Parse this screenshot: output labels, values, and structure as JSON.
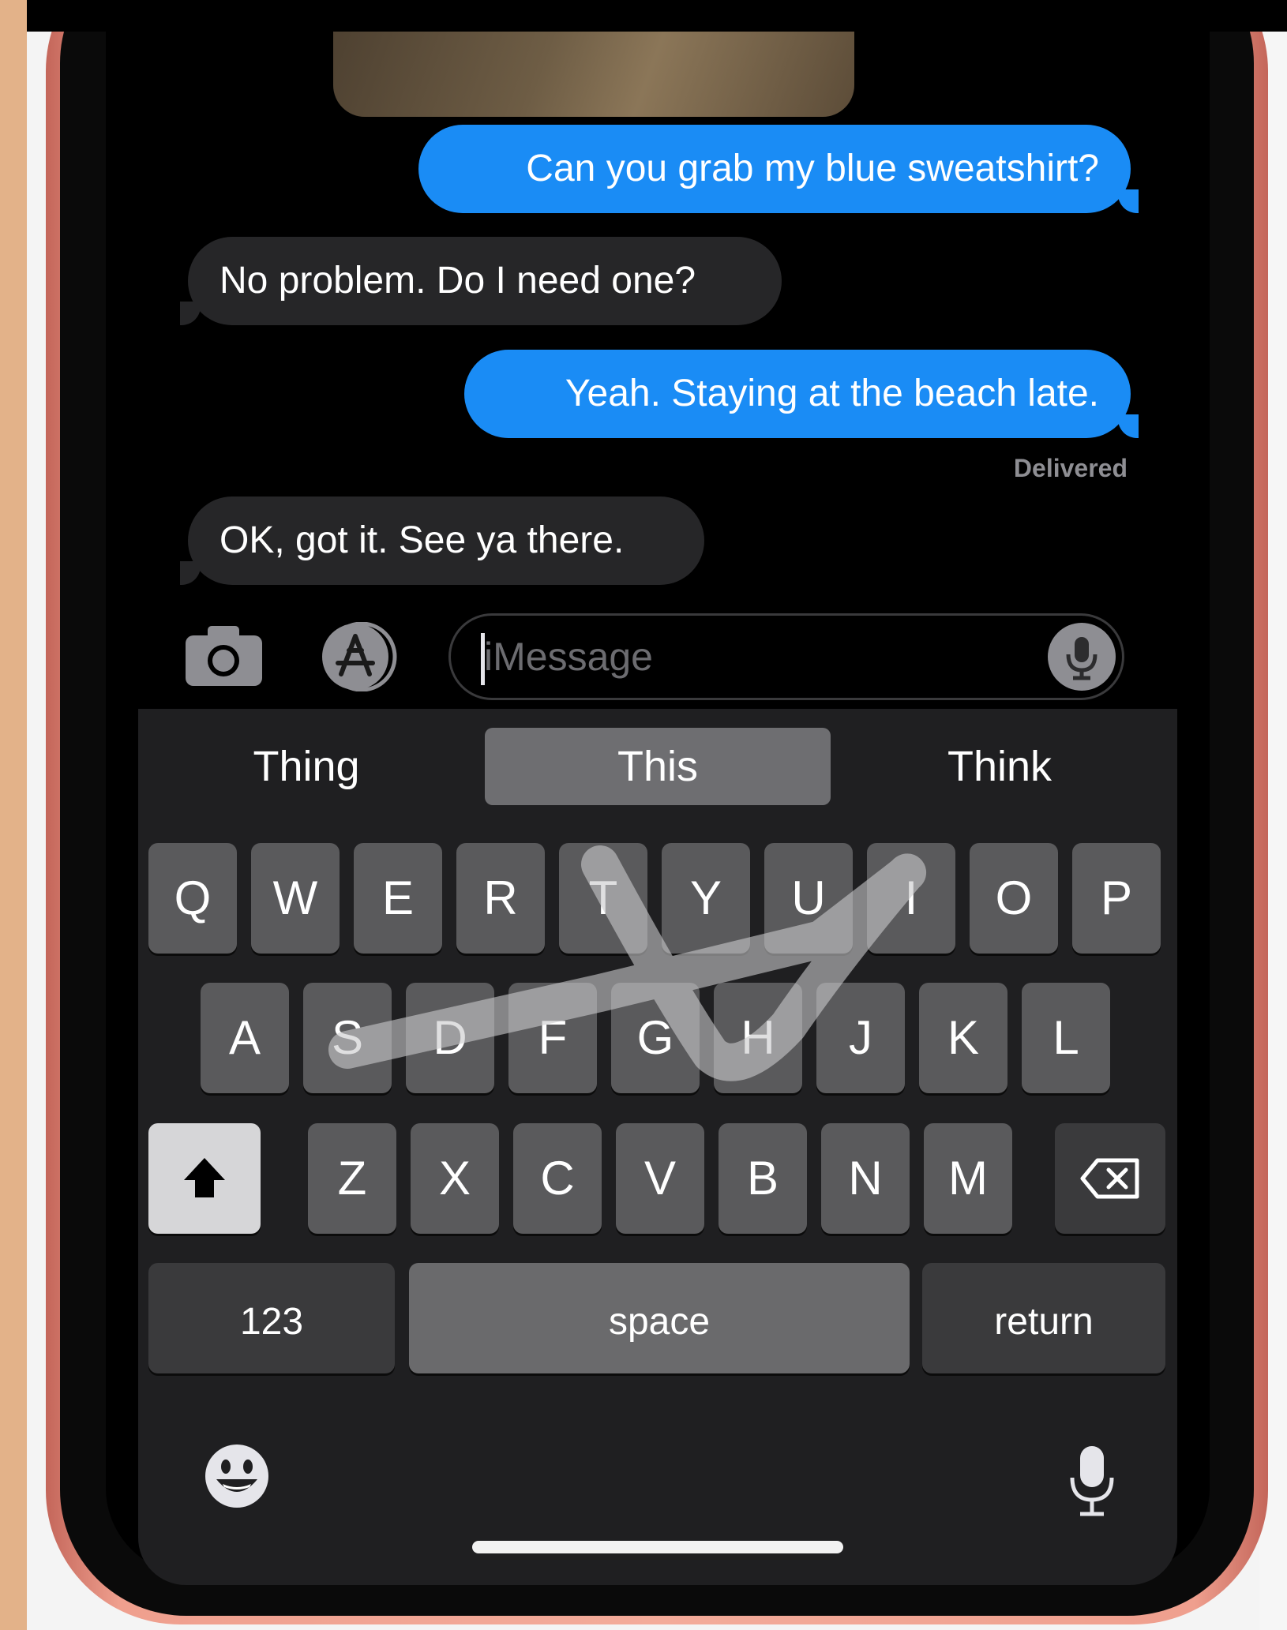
{
  "conversation": {
    "messages": [
      {
        "from": "me",
        "text": "Can you grab my blue sweatshirt?"
      },
      {
        "from": "them",
        "text": "No problem. Do I need one?"
      },
      {
        "from": "me",
        "text": "Yeah. Staying at the beach late."
      },
      {
        "from": "them",
        "text": "OK, got it. See ya there."
      }
    ],
    "status": "Delivered"
  },
  "composer": {
    "placeholder": "iMessage",
    "camera_icon": "camera-icon",
    "apps_icon": "app-store-icon",
    "mic_icon": "microphone-icon"
  },
  "keyboard": {
    "suggestions": [
      "Thing",
      "This",
      "Think"
    ],
    "rows": [
      [
        "Q",
        "W",
        "E",
        "R",
        "T",
        "Y",
        "U",
        "I",
        "O",
        "P"
      ],
      [
        "A",
        "S",
        "D",
        "F",
        "G",
        "H",
        "J",
        "K",
        "L"
      ],
      [
        "Z",
        "X",
        "C",
        "V",
        "B",
        "N",
        "M"
      ]
    ],
    "shift_icon": "shift-icon",
    "delete_icon": "delete-icon",
    "numbers_label": "123",
    "space_label": "space",
    "return_label": "return",
    "emoji_icon": "emoji-icon",
    "dictation_icon": "microphone-icon",
    "swipe_word": "This"
  },
  "colors": {
    "outgoing_bubble": "#1a8cf5",
    "incoming_bubble": "#262628",
    "phone_frame": "#f3ab9a"
  }
}
